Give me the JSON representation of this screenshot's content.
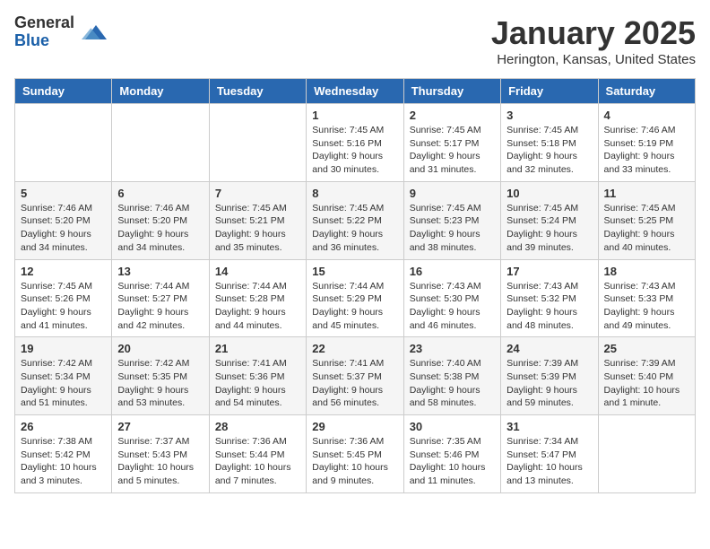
{
  "logo": {
    "general": "General",
    "blue": "Blue"
  },
  "title": "January 2025",
  "location": "Herington, Kansas, United States",
  "days_of_week": [
    "Sunday",
    "Monday",
    "Tuesday",
    "Wednesday",
    "Thursday",
    "Friday",
    "Saturday"
  ],
  "weeks": [
    [
      {
        "day": "",
        "info": ""
      },
      {
        "day": "",
        "info": ""
      },
      {
        "day": "",
        "info": ""
      },
      {
        "day": "1",
        "info": "Sunrise: 7:45 AM\nSunset: 5:16 PM\nDaylight: 9 hours\nand 30 minutes."
      },
      {
        "day": "2",
        "info": "Sunrise: 7:45 AM\nSunset: 5:17 PM\nDaylight: 9 hours\nand 31 minutes."
      },
      {
        "day": "3",
        "info": "Sunrise: 7:45 AM\nSunset: 5:18 PM\nDaylight: 9 hours\nand 32 minutes."
      },
      {
        "day": "4",
        "info": "Sunrise: 7:46 AM\nSunset: 5:19 PM\nDaylight: 9 hours\nand 33 minutes."
      }
    ],
    [
      {
        "day": "5",
        "info": "Sunrise: 7:46 AM\nSunset: 5:20 PM\nDaylight: 9 hours\nand 34 minutes."
      },
      {
        "day": "6",
        "info": "Sunrise: 7:46 AM\nSunset: 5:20 PM\nDaylight: 9 hours\nand 34 minutes."
      },
      {
        "day": "7",
        "info": "Sunrise: 7:45 AM\nSunset: 5:21 PM\nDaylight: 9 hours\nand 35 minutes."
      },
      {
        "day": "8",
        "info": "Sunrise: 7:45 AM\nSunset: 5:22 PM\nDaylight: 9 hours\nand 36 minutes."
      },
      {
        "day": "9",
        "info": "Sunrise: 7:45 AM\nSunset: 5:23 PM\nDaylight: 9 hours\nand 38 minutes."
      },
      {
        "day": "10",
        "info": "Sunrise: 7:45 AM\nSunset: 5:24 PM\nDaylight: 9 hours\nand 39 minutes."
      },
      {
        "day": "11",
        "info": "Sunrise: 7:45 AM\nSunset: 5:25 PM\nDaylight: 9 hours\nand 40 minutes."
      }
    ],
    [
      {
        "day": "12",
        "info": "Sunrise: 7:45 AM\nSunset: 5:26 PM\nDaylight: 9 hours\nand 41 minutes."
      },
      {
        "day": "13",
        "info": "Sunrise: 7:44 AM\nSunset: 5:27 PM\nDaylight: 9 hours\nand 42 minutes."
      },
      {
        "day": "14",
        "info": "Sunrise: 7:44 AM\nSunset: 5:28 PM\nDaylight: 9 hours\nand 44 minutes."
      },
      {
        "day": "15",
        "info": "Sunrise: 7:44 AM\nSunset: 5:29 PM\nDaylight: 9 hours\nand 45 minutes."
      },
      {
        "day": "16",
        "info": "Sunrise: 7:43 AM\nSunset: 5:30 PM\nDaylight: 9 hours\nand 46 minutes."
      },
      {
        "day": "17",
        "info": "Sunrise: 7:43 AM\nSunset: 5:32 PM\nDaylight: 9 hours\nand 48 minutes."
      },
      {
        "day": "18",
        "info": "Sunrise: 7:43 AM\nSunset: 5:33 PM\nDaylight: 9 hours\nand 49 minutes."
      }
    ],
    [
      {
        "day": "19",
        "info": "Sunrise: 7:42 AM\nSunset: 5:34 PM\nDaylight: 9 hours\nand 51 minutes."
      },
      {
        "day": "20",
        "info": "Sunrise: 7:42 AM\nSunset: 5:35 PM\nDaylight: 9 hours\nand 53 minutes."
      },
      {
        "day": "21",
        "info": "Sunrise: 7:41 AM\nSunset: 5:36 PM\nDaylight: 9 hours\nand 54 minutes."
      },
      {
        "day": "22",
        "info": "Sunrise: 7:41 AM\nSunset: 5:37 PM\nDaylight: 9 hours\nand 56 minutes."
      },
      {
        "day": "23",
        "info": "Sunrise: 7:40 AM\nSunset: 5:38 PM\nDaylight: 9 hours\nand 58 minutes."
      },
      {
        "day": "24",
        "info": "Sunrise: 7:39 AM\nSunset: 5:39 PM\nDaylight: 9 hours\nand 59 minutes."
      },
      {
        "day": "25",
        "info": "Sunrise: 7:39 AM\nSunset: 5:40 PM\nDaylight: 10 hours\nand 1 minute."
      }
    ],
    [
      {
        "day": "26",
        "info": "Sunrise: 7:38 AM\nSunset: 5:42 PM\nDaylight: 10 hours\nand 3 minutes."
      },
      {
        "day": "27",
        "info": "Sunrise: 7:37 AM\nSunset: 5:43 PM\nDaylight: 10 hours\nand 5 minutes."
      },
      {
        "day": "28",
        "info": "Sunrise: 7:36 AM\nSunset: 5:44 PM\nDaylight: 10 hours\nand 7 minutes."
      },
      {
        "day": "29",
        "info": "Sunrise: 7:36 AM\nSunset: 5:45 PM\nDaylight: 10 hours\nand 9 minutes."
      },
      {
        "day": "30",
        "info": "Sunrise: 7:35 AM\nSunset: 5:46 PM\nDaylight: 10 hours\nand 11 minutes."
      },
      {
        "day": "31",
        "info": "Sunrise: 7:34 AM\nSunset: 5:47 PM\nDaylight: 10 hours\nand 13 minutes."
      },
      {
        "day": "",
        "info": ""
      }
    ]
  ]
}
